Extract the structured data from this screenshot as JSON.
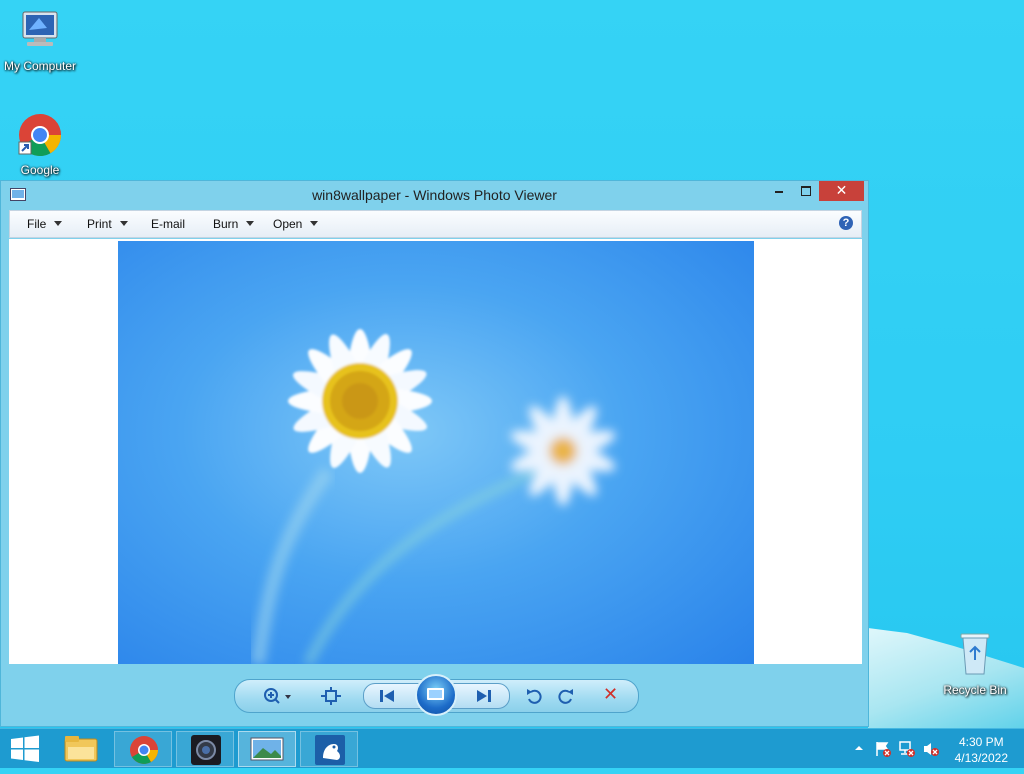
{
  "desktop": {
    "icons": [
      {
        "label": "My Computer"
      },
      {
        "label": "Google"
      },
      {
        "label": "Recycle Bin"
      }
    ]
  },
  "window": {
    "title": "win8wallpaper - Windows Photo Viewer",
    "close_glyph": "✕",
    "menu": [
      {
        "label": "File",
        "has_dropdown": true
      },
      {
        "label": "Print",
        "has_dropdown": true
      },
      {
        "label": "E-mail",
        "has_dropdown": false
      },
      {
        "label": "Burn",
        "has_dropdown": true
      },
      {
        "label": "Open",
        "has_dropdown": true
      }
    ],
    "help_glyph": "?",
    "image_icon": "daisy-wallpaper-image",
    "controls": {
      "icons": [
        "zoom-icon",
        "actual-size-icon",
        "previous-icon",
        "slideshow-icon",
        "next-icon",
        "rotate-left-icon",
        "rotate-right-icon",
        "delete-icon"
      ],
      "delete_glyph": "✕"
    }
  },
  "taskbar": {
    "items": [
      "file-explorer-icon",
      "chrome-icon",
      "camera-app-icon",
      "photo-viewer-icon",
      "frog-app-icon"
    ],
    "clock": {
      "time": "4:30 PM",
      "date": "4/13/2022"
    }
  },
  "colors": {
    "desktop": "#35d3f5",
    "taskbar": "#1e9bd0",
    "close_button": "#c8413a",
    "window_frame": "#7fd1ec"
  }
}
